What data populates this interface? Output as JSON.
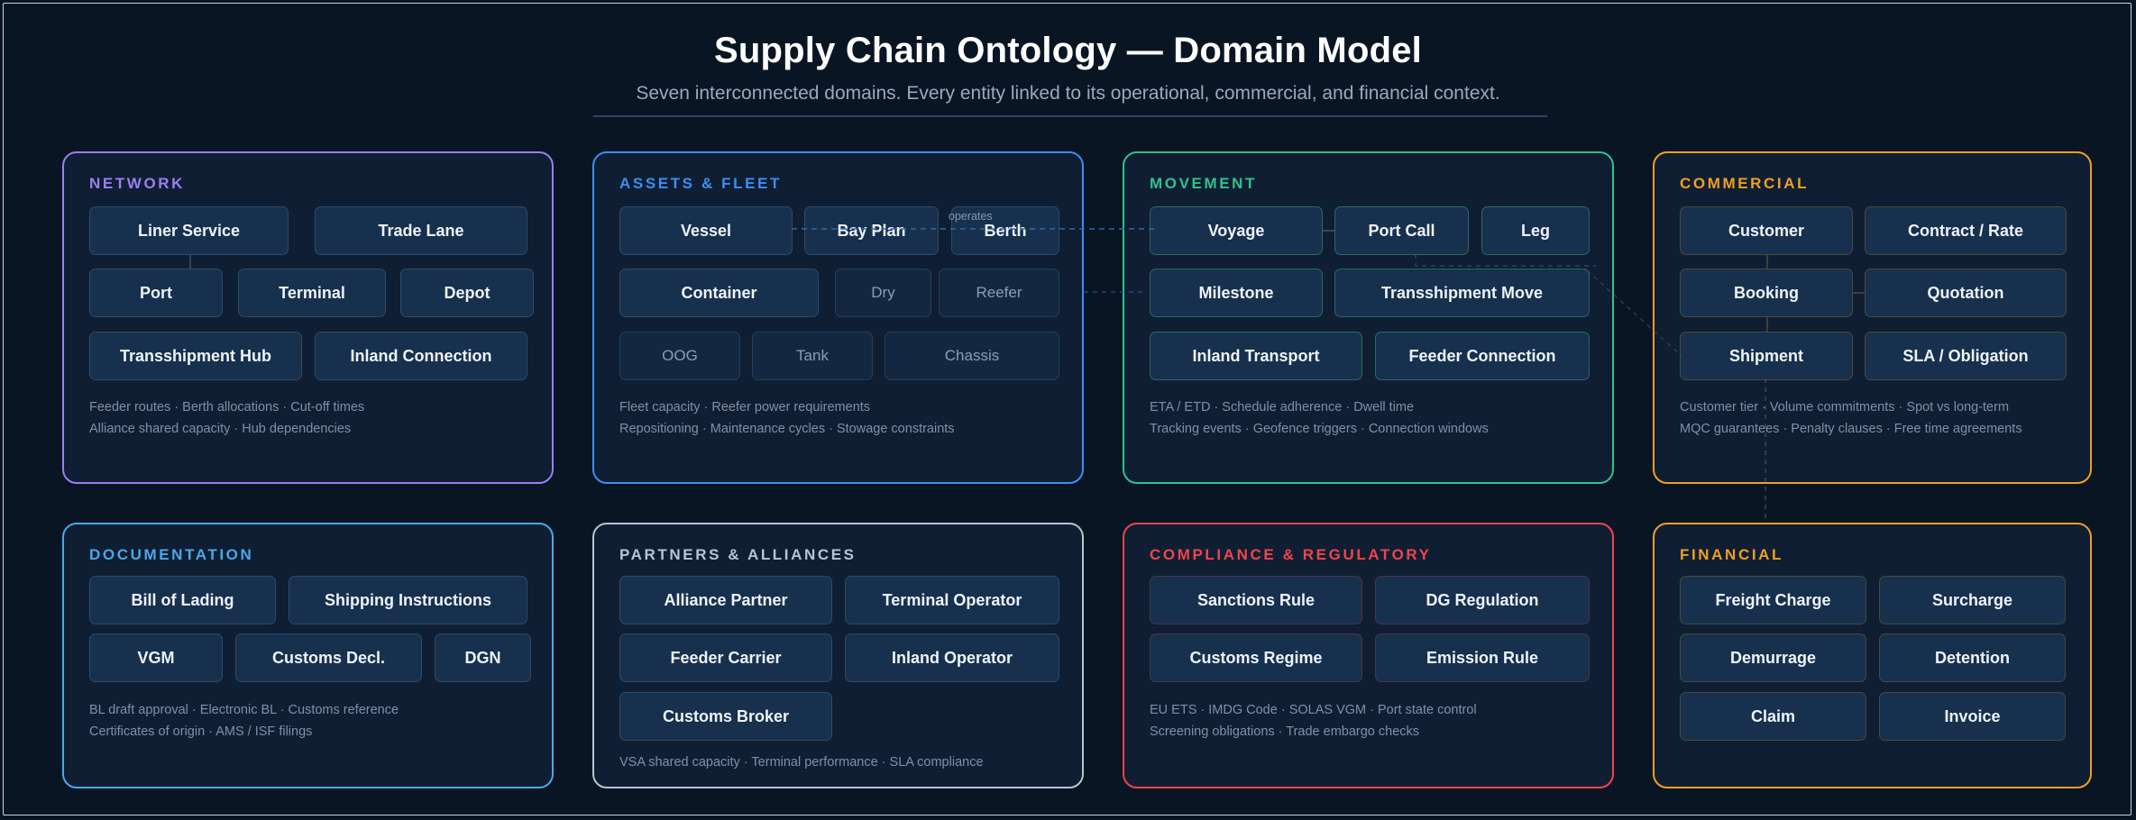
{
  "header": {
    "title": "Supply Chain Ontology — Domain Model",
    "subtitle": "Seven interconnected domains. Every entity linked to its operational, commercial, and financial context."
  },
  "colors": {
    "background": "#0a1524",
    "network": "#9b7ff0",
    "assets_fleet": "#3d8ef0",
    "movement": "#2fc28e",
    "commercial": "#f0a020",
    "documentation": "#4aa8e8",
    "partners_alliances": "#b9c4d2",
    "compliance_regulatory": "#f0454c",
    "financial": "#f0a020"
  },
  "relations": {
    "operates": "operates"
  },
  "panels": {
    "network": {
      "title": "NETWORK",
      "nodes": [
        "Liner Service",
        "Trade Lane",
        "Port",
        "Terminal",
        "Depot",
        "Transshipment Hub",
        "Inland Connection"
      ],
      "notes": [
        "Feeder routes · Berth allocations · Cut-off times",
        "Alliance shared capacity · Hub dependencies"
      ]
    },
    "assets": {
      "title": "ASSETS & FLEET",
      "nodes": [
        "Vessel",
        "Bay Plan",
        "Berth",
        "Container",
        "Dry",
        "Reefer",
        "OOG",
        "Tank",
        "Chassis"
      ],
      "notes": [
        "Fleet capacity · Reefer power requirements",
        "Repositioning · Maintenance cycles · Stowage constraints"
      ]
    },
    "movement": {
      "title": "MOVEMENT",
      "nodes": [
        "Voyage",
        "Port Call",
        "Leg",
        "Milestone",
        "Transshipment Move",
        "Inland Transport",
        "Feeder Connection"
      ],
      "notes": [
        "ETA / ETD · Schedule adherence · Dwell time",
        "Tracking events · Geofence triggers · Connection windows"
      ]
    },
    "commercial": {
      "title": "COMMERCIAL",
      "nodes": [
        "Customer",
        "Contract / Rate",
        "Booking",
        "Quotation",
        "Shipment",
        "SLA / Obligation"
      ],
      "notes": [
        "Customer tier · Volume commitments · Spot vs long-term",
        "MQC guarantees · Penalty clauses · Free time agreements"
      ]
    },
    "documentation": {
      "title": "DOCUMENTATION",
      "nodes": [
        "Bill of Lading",
        "Shipping Instructions",
        "VGM",
        "Customs Decl.",
        "DGN"
      ],
      "notes": [
        "BL draft approval · Electronic BL · Customs reference",
        "Certificates of origin · AMS / ISF filings"
      ]
    },
    "partners": {
      "title": "PARTNERS & ALLIANCES",
      "nodes": [
        "Alliance Partner",
        "Terminal Operator",
        "Feeder Carrier",
        "Inland Operator",
        "Customs Broker"
      ],
      "notes": [
        "VSA shared capacity · Terminal performance · SLA compliance"
      ]
    },
    "compliance": {
      "title": "COMPLIANCE & REGULATORY",
      "nodes": [
        "Sanctions Rule",
        "DG Regulation",
        "Customs Regime",
        "Emission Rule"
      ],
      "notes": [
        "EU ETS · IMDG Code · SOLAS VGM · Port state control",
        "Screening obligations · Trade embargo checks"
      ]
    },
    "financial": {
      "title": "FINANCIAL",
      "nodes": [
        "Freight Charge",
        "Surcharge",
        "Demurrage",
        "Detention",
        "Claim",
        "Invoice"
      ],
      "notes": []
    }
  }
}
